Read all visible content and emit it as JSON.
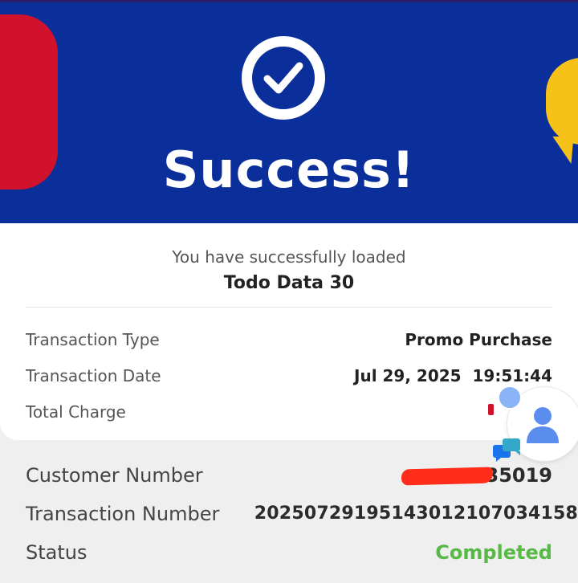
{
  "header": {
    "title": "Success!"
  },
  "summary": {
    "subtitle": "You have successfully loaded",
    "product": "Todo Data 30"
  },
  "details": [
    {
      "label": "Transaction Type",
      "value": "Promo Purchase"
    },
    {
      "label": "Transaction Date",
      "value": "Jul 29, 2025  19:51:44"
    },
    {
      "label": "Total Charge",
      "value": ""
    }
  ],
  "extra": [
    {
      "label": "Customer Number",
      "value": "35019"
    },
    {
      "label": "Transaction Number",
      "value": "20250729195143012107034158"
    },
    {
      "label": "Status",
      "value": "Completed"
    }
  ],
  "icons": {
    "check": "check-circle-icon",
    "assistant": "person-assistant-icon",
    "chat": "chat-bubbles-icon"
  },
  "colors": {
    "banner": "#0a2f9a",
    "accent_red": "#d0122d",
    "accent_yellow": "#f6c21a",
    "status_green": "#58b947",
    "redaction": "#ff2d1a"
  }
}
